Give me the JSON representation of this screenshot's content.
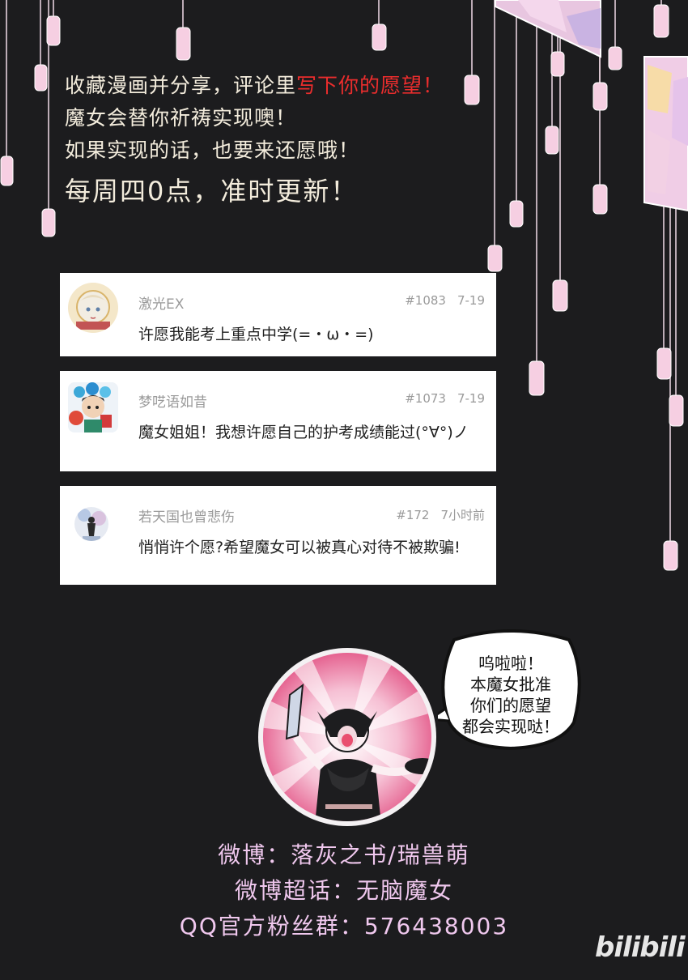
{
  "header": {
    "line1_a": "收藏漫画并分享，评论里",
    "line1_b": "写下你的愿望！",
    "line2": "魔女会替你祈祷实现噢！",
    "line3": "如果实现的话，也要来还愿哦！",
    "line4": "每周四0点，准时更新！",
    "highlight_color": "#ea2d2d"
  },
  "comments": [
    {
      "user": "激光EX",
      "id": "#1083",
      "time": "7-19",
      "text": "许愿我能考上重点中学(=・ω・=)",
      "avatar": "blonde-character-avatar"
    },
    {
      "user": "梦呓语如昔",
      "id": "#1073",
      "time": "7-19",
      "text": "魔女姐姐！我想许愿自己的护考成绩能过(°∀°)ノ",
      "avatar": "flower-boy-avatar"
    },
    {
      "user": "若天国也曾悲伤",
      "id": "#172",
      "time": "7小时前",
      "text": "悄悄许个愿?希望魔女可以被真心对待不被欺骗!",
      "avatar": "silhouette-avatar"
    }
  ],
  "bubble": {
    "text": "呜啦啦！\n本魔女批准\n你们的愿望\n都会实现哒！"
  },
  "footer": {
    "weibo": "微博：落灰之书/瑞兽萌",
    "topic": "微博超话：无脑魔女",
    "qq": "QQ官方粉丝群：576438003"
  },
  "logo": "bilibili"
}
